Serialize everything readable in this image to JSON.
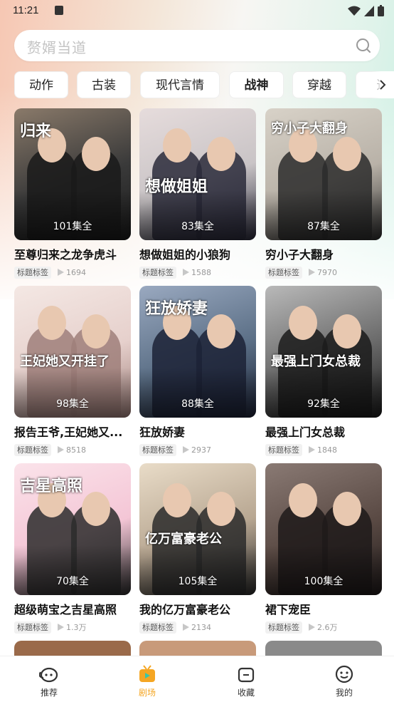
{
  "status_bar": {
    "time": "11:21"
  },
  "search": {
    "placeholder": "赘婿当道"
  },
  "categories": [
    {
      "label": "动作",
      "active": false
    },
    {
      "label": "古装",
      "active": false
    },
    {
      "label": "现代言情",
      "active": false
    },
    {
      "label": "战神",
      "active": true
    },
    {
      "label": "穿越",
      "active": false
    },
    {
      "label": "逆",
      "active": false
    }
  ],
  "dramas": [
    {
      "title": "至尊归来之龙争虎斗",
      "episodes": "101集全",
      "tag": "标题标签",
      "plays": "1694",
      "colors": [
        "#3a3a3a",
        "#1a1a1a",
        "#8a7a6a"
      ],
      "art_text": "归来"
    },
    {
      "title": "想做姐姐的小狼狗",
      "episodes": "83集全",
      "tag": "标题标签",
      "plays": "1588",
      "colors": [
        "#c9c4c6",
        "#2a2a3a",
        "#e6dcdc"
      ],
      "art_text": "想做姐姐"
    },
    {
      "title": "穷小子大翻身",
      "episodes": "87集全",
      "tag": "标题标签",
      "plays": "7970",
      "colors": [
        "#b9b2a8",
        "#2c2c2c",
        "#d8d2c8"
      ],
      "art_text": "穷小子大翻身"
    },
    {
      "title": "报告王爷,王妃她又...",
      "episodes": "98集全",
      "tag": "标题标签",
      "plays": "8518",
      "colors": [
        "#e6d0cc",
        "#9f7f7a",
        "#f4e8e4"
      ],
      "art_text": "王妃她又开挂了"
    },
    {
      "title": "狂放娇妻",
      "episodes": "88集全",
      "tag": "标题标签",
      "plays": "2937",
      "colors": [
        "#5b6f86",
        "#1c2236",
        "#9aa9c0"
      ],
      "art_text": "狂放娇妻"
    },
    {
      "title": "最强上门女总裁",
      "episodes": "92集全",
      "tag": "标题标签",
      "plays": "1848",
      "colors": [
        "#6a6a6a",
        "#1b1b1b",
        "#b9b9b9"
      ],
      "art_text": "最强上门女总裁"
    },
    {
      "title": "超级萌宝之吉星高照",
      "episodes": "70集全",
      "tag": "标题标签",
      "plays": "1.3万",
      "colors": [
        "#f4c6d6",
        "#2b2b2b",
        "#fbe3ea"
      ],
      "art_text": "吉星高照"
    },
    {
      "title": "我的亿万富豪老公",
      "episodes": "105集全",
      "tag": "标题标签",
      "plays": "2134",
      "colors": [
        "#b8a792",
        "#2a2a2a",
        "#e9dcc8"
      ],
      "art_text": "亿万富豪老公"
    },
    {
      "title": "裙下宠臣",
      "episodes": "100集全",
      "tag": "标题标签",
      "plays": "2.6万",
      "colors": [
        "#5a4a44",
        "#1f1a1a",
        "#8a7a74"
      ],
      "art_text": ""
    }
  ],
  "nav": {
    "items": [
      {
        "label": "推荐",
        "icon": "planet-face-icon",
        "active": false
      },
      {
        "label": "剧场",
        "icon": "tv-icon",
        "active": true
      },
      {
        "label": "收藏",
        "icon": "folder-icon",
        "active": false
      },
      {
        "label": "我的",
        "icon": "smile-face-icon",
        "active": false
      }
    ],
    "active_color": "#f5a623"
  }
}
